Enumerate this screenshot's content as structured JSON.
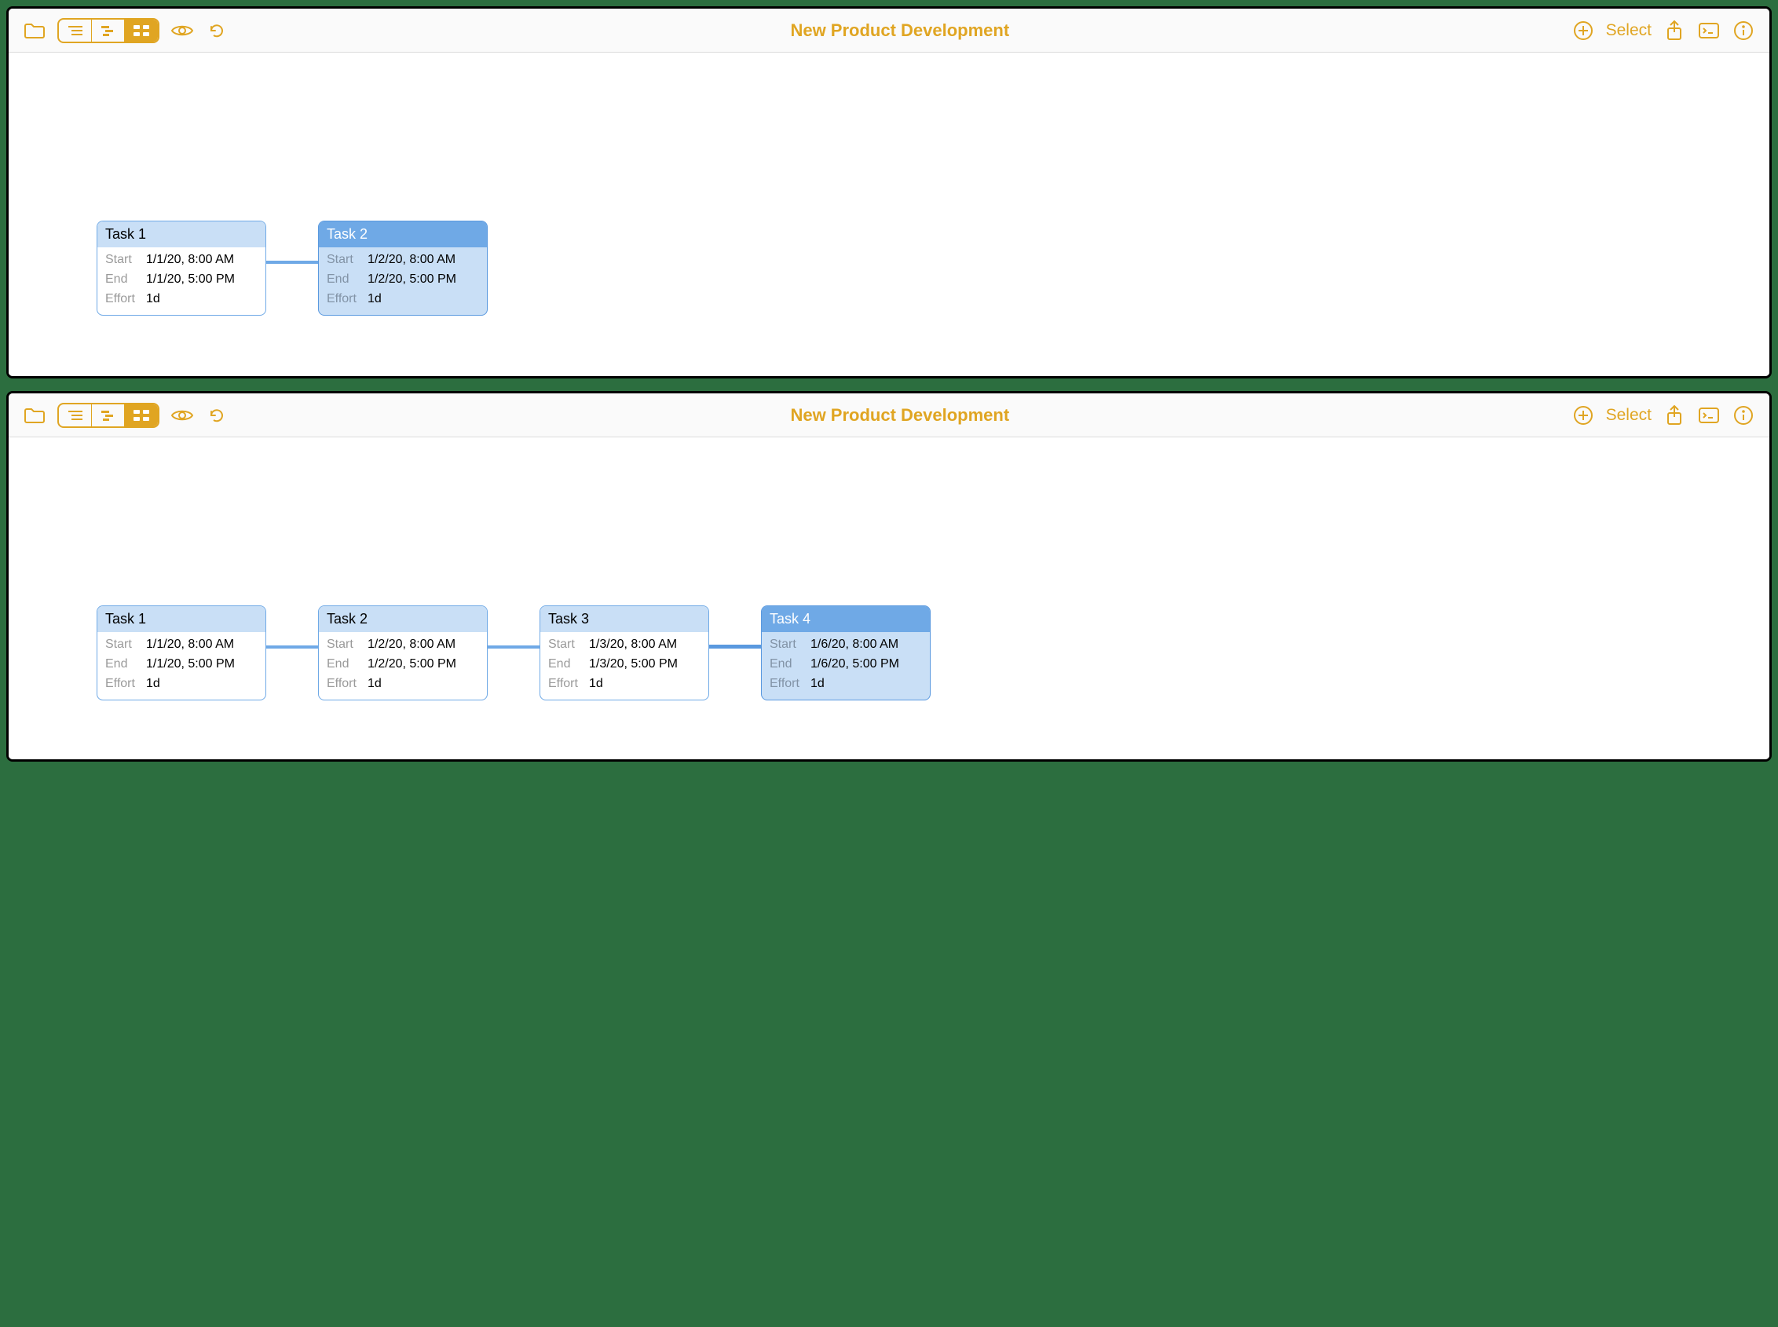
{
  "colors": {
    "accent": "#e0a522",
    "card_border": "#6fa9e6",
    "card_header": "#c9dff6",
    "card_selected": "#6fa9e6"
  },
  "toolbar": {
    "title": "New Product Development",
    "select": "Select",
    "icons": {
      "folder": "folder-icon",
      "view_outline": "outline-view-icon",
      "view_gantt": "gantt-view-icon",
      "view_network": "network-view-icon",
      "eye": "eye-icon",
      "undo": "undo-icon",
      "add": "add-icon",
      "share": "share-icon",
      "console": "console-icon",
      "info": "info-icon"
    }
  },
  "labels": {
    "start": "Start",
    "end": "End",
    "effort": "Effort"
  },
  "panels": [
    {
      "tasks": [
        {
          "name": "Task 1",
          "start": "1/1/20, 8:00 AM",
          "end": "1/1/20, 5:00 PM",
          "effort": "1d",
          "selected": false
        },
        {
          "name": "Task 2",
          "start": "1/2/20, 8:00 AM",
          "end": "1/2/20, 5:00 PM",
          "effort": "1d",
          "selected": true
        }
      ]
    },
    {
      "tasks": [
        {
          "name": "Task 1",
          "start": "1/1/20, 8:00 AM",
          "end": "1/1/20, 5:00 PM",
          "effort": "1d",
          "selected": false
        },
        {
          "name": "Task 2",
          "start": "1/2/20, 8:00 AM",
          "end": "1/2/20, 5:00 PM",
          "effort": "1d",
          "selected": false
        },
        {
          "name": "Task 3",
          "start": "1/3/20, 8:00 AM",
          "end": "1/3/20, 5:00 PM",
          "effort": "1d",
          "selected": false
        },
        {
          "name": "Task 4",
          "start": "1/6/20, 8:00 AM",
          "end": "1/6/20, 5:00 PM",
          "effort": "1d",
          "selected": true
        }
      ]
    }
  ]
}
